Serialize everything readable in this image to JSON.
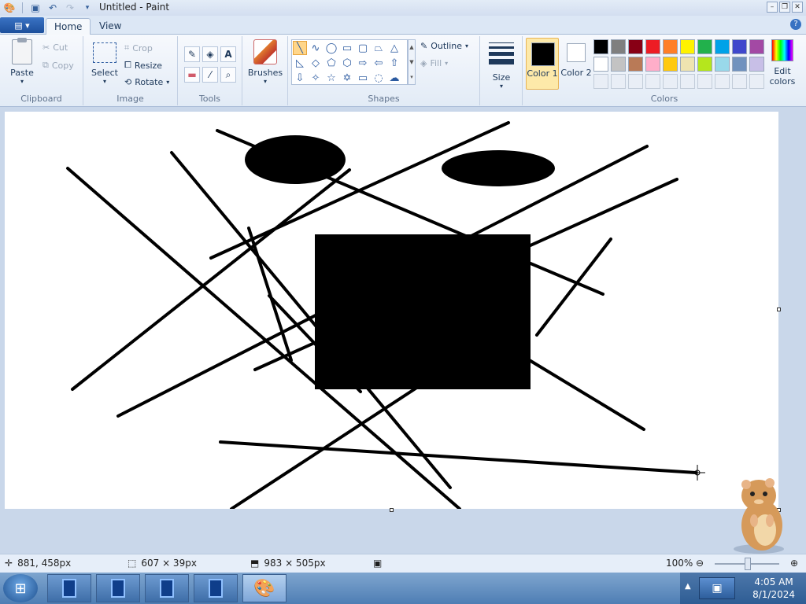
{
  "window": {
    "title": "Untitled - Paint"
  },
  "tabs": {
    "home": "Home",
    "view": "View"
  },
  "clipboard": {
    "paste": "Paste",
    "cut": "Cut",
    "copy": "Copy",
    "label": "Clipboard"
  },
  "image": {
    "select": "Select",
    "crop": "Crop",
    "resize": "Resize",
    "rotate": "Rotate",
    "label": "Image"
  },
  "tools": {
    "label": "Tools"
  },
  "brushes": {
    "label": "Brushes"
  },
  "shapes": {
    "outline": "Outline",
    "fill": "Fill",
    "label": "Shapes"
  },
  "size": {
    "label": "Size"
  },
  "colors": {
    "color1_label": "Color 1",
    "color2_label": "Color 2",
    "edit_colors": "Edit colors",
    "label": "Colors",
    "color1": "#000000",
    "color2": "#ffffff",
    "palette": [
      "#000000",
      "#7f7f7f",
      "#880015",
      "#ed1c24",
      "#ff7f27",
      "#fff200",
      "#22b14c",
      "#00a2e8",
      "#3f48cc",
      "#a349a4",
      "#ffffff",
      "#c3c3c3",
      "#b97a57",
      "#ffaec9",
      "#ffc90e",
      "#efe4b0",
      "#b5e61d",
      "#99d9ea",
      "#7092be",
      "#c8bfe7"
    ]
  },
  "status": {
    "cursor_pos": "881, 458px",
    "selection_size": "607 × 39px",
    "canvas_size": "983 × 505px",
    "zoom": "100%"
  },
  "clock": {
    "time": "4:05 AM",
    "date": "8/1/2024"
  }
}
